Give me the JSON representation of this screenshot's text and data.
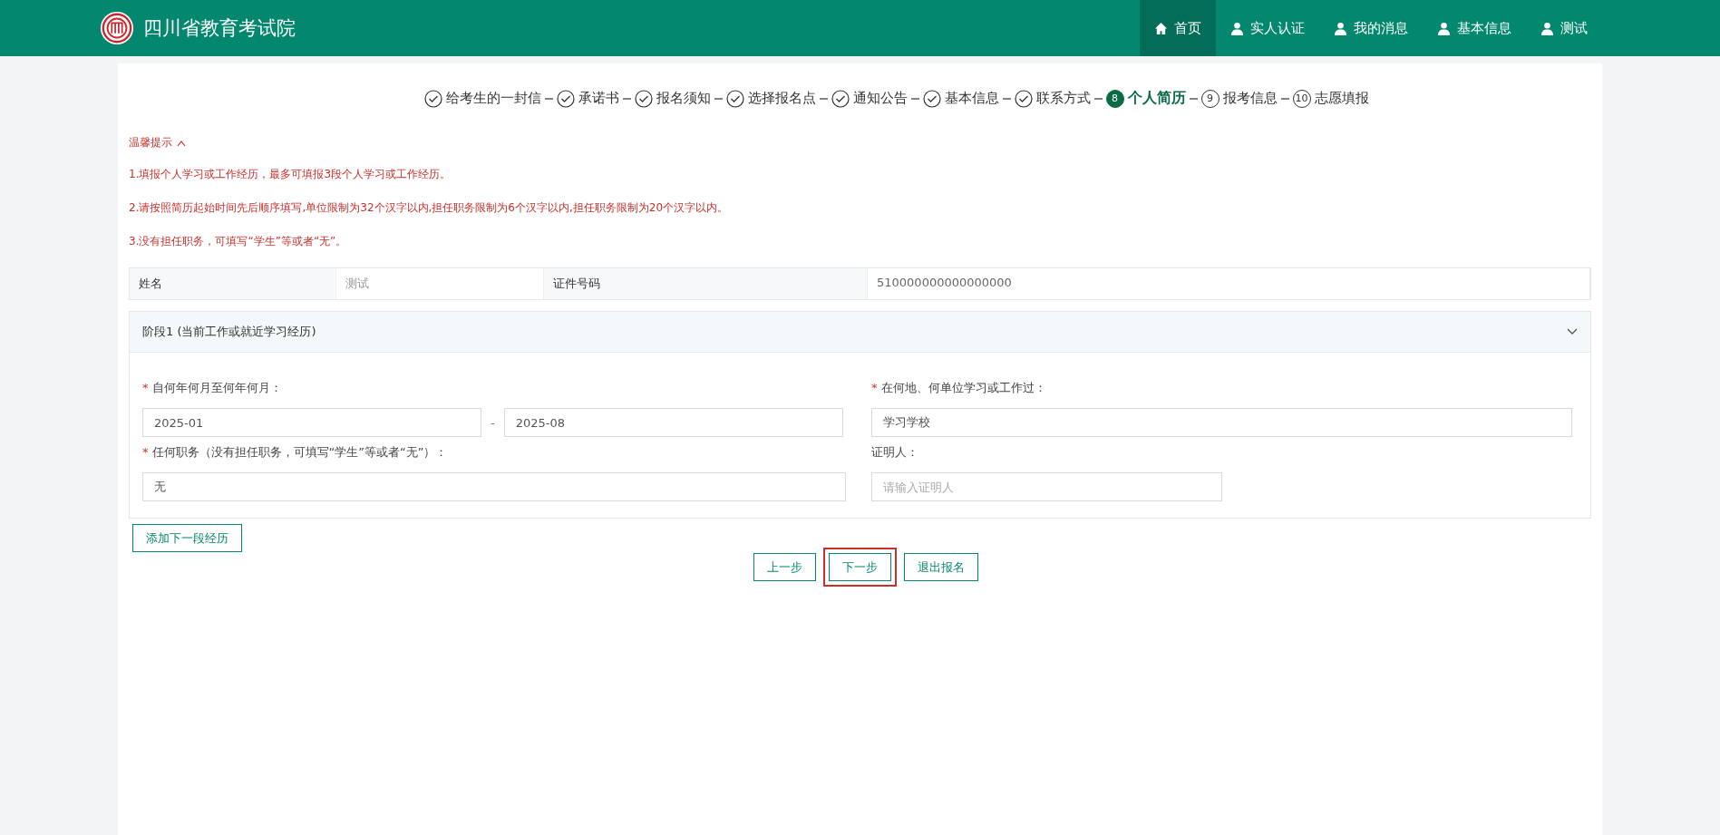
{
  "header": {
    "title": "四川省教育考试院",
    "nav": [
      {
        "label": "首页",
        "kind": "home",
        "selected": true
      },
      {
        "label": "实人认证",
        "kind": "user",
        "selected": false
      },
      {
        "label": "我的消息",
        "kind": "user",
        "selected": false
      },
      {
        "label": "基本信息",
        "kind": "user",
        "selected": false
      },
      {
        "label": "测试",
        "kind": "user",
        "selected": false
      }
    ]
  },
  "steps": [
    {
      "label": "给考生的一封信",
      "kind": "done"
    },
    {
      "label": "承诺书",
      "kind": "done"
    },
    {
      "label": "报名须知",
      "kind": "done"
    },
    {
      "label": "选择报名点",
      "kind": "done"
    },
    {
      "label": "通知公告",
      "kind": "done"
    },
    {
      "label": "基本信息",
      "kind": "done"
    },
    {
      "label": "联系方式",
      "kind": "done"
    },
    {
      "label": "个人简历",
      "kind": "current",
      "number": "8"
    },
    {
      "label": "报考信息",
      "kind": "todo",
      "number": "9"
    },
    {
      "label": "志愿填报",
      "kind": "todo",
      "number": "10"
    }
  ],
  "tips": {
    "title": "温馨提示",
    "expanded": true,
    "items": [
      "1.填报个人学习或工作经历，最多可填报3段个人学习或工作经历。",
      "2.请按照简历起始时间先后顺序填写,单位限制为32个汉字以内,担任职务限制为6个汉字以内,担任职务限制为20个汉字以内。",
      "3.没有担任职务，可填写“学生”等或者“无”。"
    ]
  },
  "info_table": {
    "cells": [
      "姓名",
      "测试",
      "证件号码",
      "510000000000000000"
    ]
  },
  "stage": {
    "title": "阶段1 (当前工作或就近学习经历)",
    "expanded": true,
    "period": {
      "label": "自何年何月至何年何月：",
      "required_mark": "*",
      "from": "2025-01",
      "separator": "-",
      "to": "2025-08"
    },
    "unit": {
      "label": "在何地、何单位学习或工作过：",
      "required_mark": "*",
      "value": "学习学校"
    },
    "position": {
      "label": "任何职务（没有担任职务，可填写“学生”等或者“无”）：",
      "required_mark": "*",
      "value": "无"
    },
    "witness": {
      "label": "证明人：",
      "placeholder": "请输入证明人"
    }
  },
  "add_button": "添加下一段经历",
  "actions": [
    {
      "label": "上一步",
      "highlighted": false
    },
    {
      "label": "下一步",
      "highlighted": true
    },
    {
      "label": "退出报名",
      "highlighted": false
    }
  ]
}
